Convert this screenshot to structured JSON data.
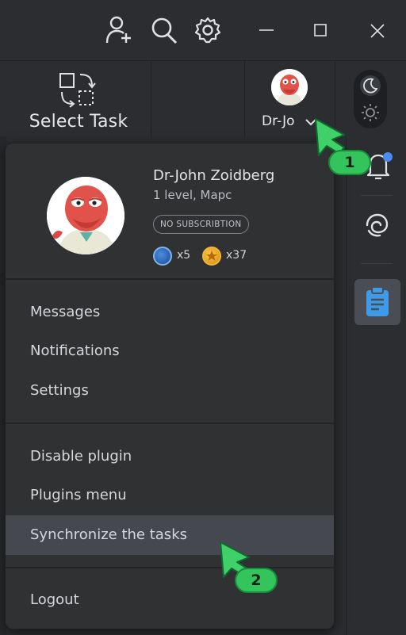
{
  "titlebar": {
    "icons": [
      "add-user-icon",
      "search-icon",
      "gear-icon",
      "minimize-icon",
      "maximize-icon",
      "close-icon"
    ]
  },
  "toolbar": {
    "select_task_label": "Select Task",
    "user_short_name": "Dr-Jo"
  },
  "profile": {
    "name": "Dr-John Zoidberg",
    "level": "1 level, Mapc",
    "subscription_badge": "NO SUBSCRIBTION",
    "blue_coin_count": "x5",
    "gold_coin_count": "x37"
  },
  "menu": {
    "group1": [
      "Messages",
      "Notifications",
      "Settings"
    ],
    "group2": [
      "Disable plugin",
      "Plugins menu",
      "Synchronize the tasks"
    ],
    "group3": [
      "Logout"
    ],
    "active_item": "Synchronize the tasks"
  },
  "callouts": [
    "1",
    "2"
  ],
  "colors": {
    "background": "#2b2d30",
    "dropdown": "#2f3133",
    "active_item": "#45494f",
    "callout_green": "#33c45c",
    "notification_dot": "#4a8cf0",
    "clipboard_blue": "#3d9be9"
  }
}
